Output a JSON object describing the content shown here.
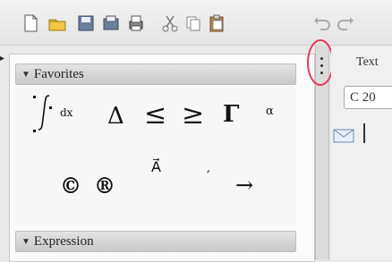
{
  "toolbar": {
    "buttons": [
      {
        "icon": "new-document-icon"
      },
      {
        "icon": "open-folder-icon"
      },
      {
        "icon": "save-icon"
      },
      {
        "icon": "save-as-icon"
      },
      {
        "icon": "print-icon"
      },
      {
        "icon": "cut-icon"
      },
      {
        "icon": "copy-icon"
      },
      {
        "icon": "paste-icon"
      },
      {
        "icon": "undo-icon"
      },
      {
        "icon": "redo-icon"
      }
    ]
  },
  "palette": {
    "favorites_label": "Favorites",
    "expression_label": "Expression",
    "symbols": {
      "integral_var": "dx",
      "delta": "Δ",
      "le": "≤",
      "ge": "≥",
      "gamma": "Γ",
      "alpha": "α",
      "copyright": "©",
      "registered": "®",
      "vector": "A⃗",
      "prime": "′",
      "arrow": "→"
    }
  },
  "editor": {
    "text_label": "Text",
    "field_value": "C 20"
  },
  "colors": {
    "highlight_ring": "#e8385a"
  }
}
